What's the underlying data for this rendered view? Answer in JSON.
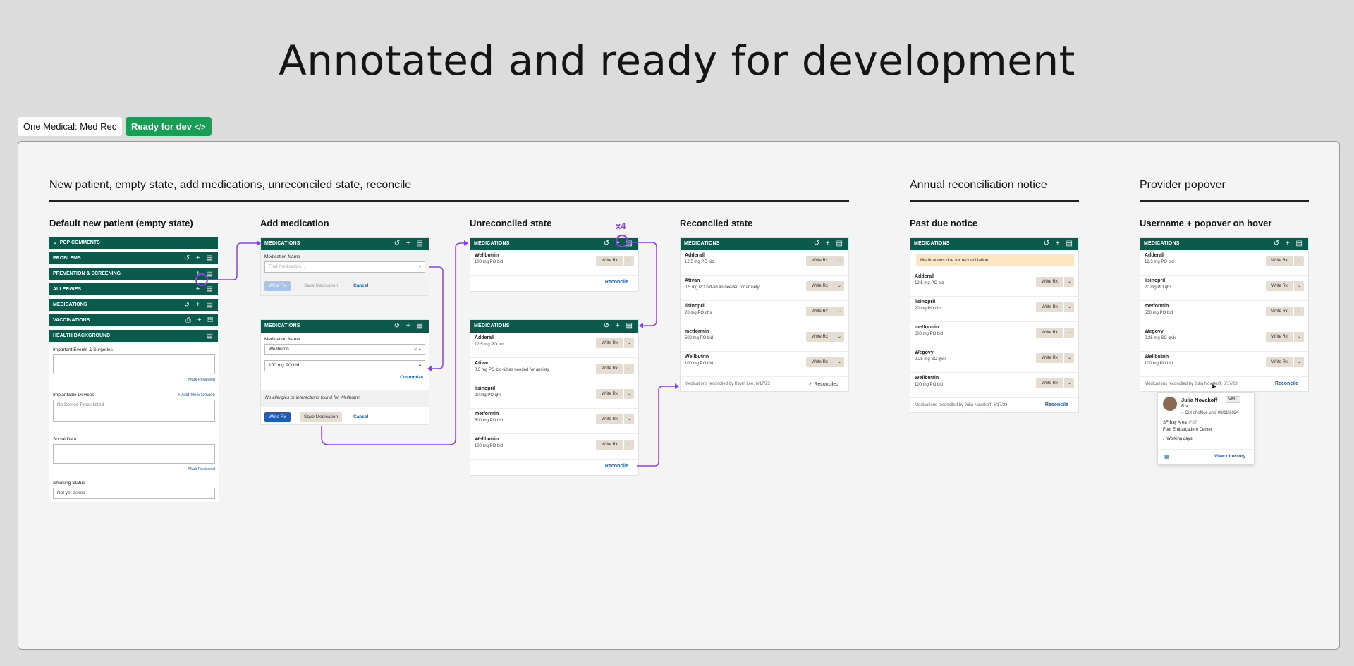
{
  "headline": "Annotated and ready for development",
  "pills": {
    "file": "One Medical: Med Rec",
    "status": "Ready for dev",
    "status_icon": "</>"
  },
  "sections": {
    "main": "New patient, empty state, add medications, unreconciled state, reconcile",
    "annual": "Annual reconciliation notice",
    "provider": "Provider popover"
  },
  "columns": {
    "default": "Default new patient (empty state)",
    "add": "Add medication",
    "unreconciled": "Unreconciled state",
    "reconciled": "Reconciled state",
    "pastdue": "Past due notice",
    "username": "Username + popover on hover"
  },
  "annotation": {
    "x4": "x4"
  },
  "chart_sections": [
    {
      "label": "PCP COMMENTS",
      "icons": ""
    },
    {
      "label": "PROBLEMS",
      "icons": "↺ + ▤"
    },
    {
      "label": "PREVENTION & SCREENING",
      "icons": "+ ▤"
    },
    {
      "label": "ALLERGIES",
      "icons": "+ ▤"
    },
    {
      "label": "MEDICATIONS",
      "icons": "↺ + ▤"
    },
    {
      "label": "VACCINATIONS",
      "icons": "⎙ + ▤"
    },
    {
      "label": "HEALTH BACKGROUND",
      "icons": "▤"
    }
  ],
  "health_background": {
    "events_label": "Important Events & Surgeries",
    "mark_reviewed": "Mark Reviewed",
    "devices_label": "Implantable Devices",
    "add_device": "+ Add New Device",
    "devices_placeholder": "No Device Types listed",
    "social_label": "Social Data",
    "smoking_label": "Smoking Status",
    "smoking_value": "Not yet asked"
  },
  "add_form": {
    "header": "MEDICATIONS",
    "name_label": "Medication Name",
    "placeholder": "Find medication...",
    "write_rx": "Write Rx",
    "save": "Save Medication",
    "cancel": "Cancel",
    "selected_med": "Wellbutrin",
    "selected_dose": "100 mg PO bid",
    "customize": "Customize",
    "no_allergies": "No allergies or interactions found for Wellbutrin"
  },
  "panel_header": "MEDICATIONS",
  "write_rx_label": "Write Rx",
  "reconcile_label": "Reconcile",
  "unreconciled_single": [
    {
      "name": "Wellbutrin",
      "dose": "100 mg PO bid"
    }
  ],
  "unreconciled_list": [
    {
      "name": "Adderall",
      "dose": "12.5 mg PO bid"
    },
    {
      "name": "Ativan",
      "dose": "0.5 mg PO bid-tid as needed for anxiety"
    },
    {
      "name": "lisinopril",
      "dose": "20 mg PO qhs"
    },
    {
      "name": "metformin",
      "dose": "500 mg PO bid"
    },
    {
      "name": "Wellbutrin",
      "dose": "100 mg PO bid"
    }
  ],
  "reconciled_list": [
    {
      "name": "Adderall",
      "dose": "12.5 mg PO bid"
    },
    {
      "name": "Ativan",
      "dose": "0.5 mg PO bid-tid as needed for anxiety"
    },
    {
      "name": "lisinopril",
      "dose": "20 mg PO qhs"
    },
    {
      "name": "metformin",
      "dose": "500 mg PO bid"
    },
    {
      "name": "Wellbutrin",
      "dose": "100 mg PO bid"
    }
  ],
  "reconciled_footer": {
    "text": "Medications reconciled by Kevin Lee, 6/17/23",
    "status": "✓ Reconciled"
  },
  "pastdue": {
    "notice": "Medications due for reconciliation.",
    "list": [
      {
        "name": "Adderall",
        "dose": "12.5 mg PO bid"
      },
      {
        "name": "lisinopril",
        "dose": "20 mg PO qhs"
      },
      {
        "name": "metformin",
        "dose": "500 mg PO bid"
      },
      {
        "name": "Wegovy",
        "dose": "0.25 mg SC qwk"
      },
      {
        "name": "Wellbutrin",
        "dose": "100 mg PO bid"
      }
    ],
    "footer": "Medications reconciled by Julia Novakoff, 6/17/23"
  },
  "provider": {
    "list": [
      {
        "name": "Adderall",
        "dose": "12.5 mg PO bid"
      },
      {
        "name": "lisinopril",
        "dose": "20 mg PO qhs"
      },
      {
        "name": "metformin",
        "dose": "500 mg PO bid"
      },
      {
        "name": "Wegovy",
        "dose": "0.25 mg SC qwk"
      },
      {
        "name": "Wellbutrin",
        "dose": "100 mg PO bid"
      }
    ],
    "footer": "Medications reconciled by Julia Novakoff, 6/17/23",
    "popover": {
      "name": "Julia Novakoff",
      "badge": "VMT",
      "role": "RN",
      "status": "Out of office until 08/11/2024",
      "location": "SF Bay Area",
      "tz": "PST",
      "office": "Four Embarcadero Center",
      "working_days": "Working days",
      "view_directory": "View directory"
    }
  },
  "colors": {
    "header": "#0b5a4b",
    "accent": "#8a3ef0",
    "link": "#1d5fb8",
    "ready": "#1a9d55",
    "chip": "#e5ddd2",
    "notice": "#fde6c4"
  }
}
